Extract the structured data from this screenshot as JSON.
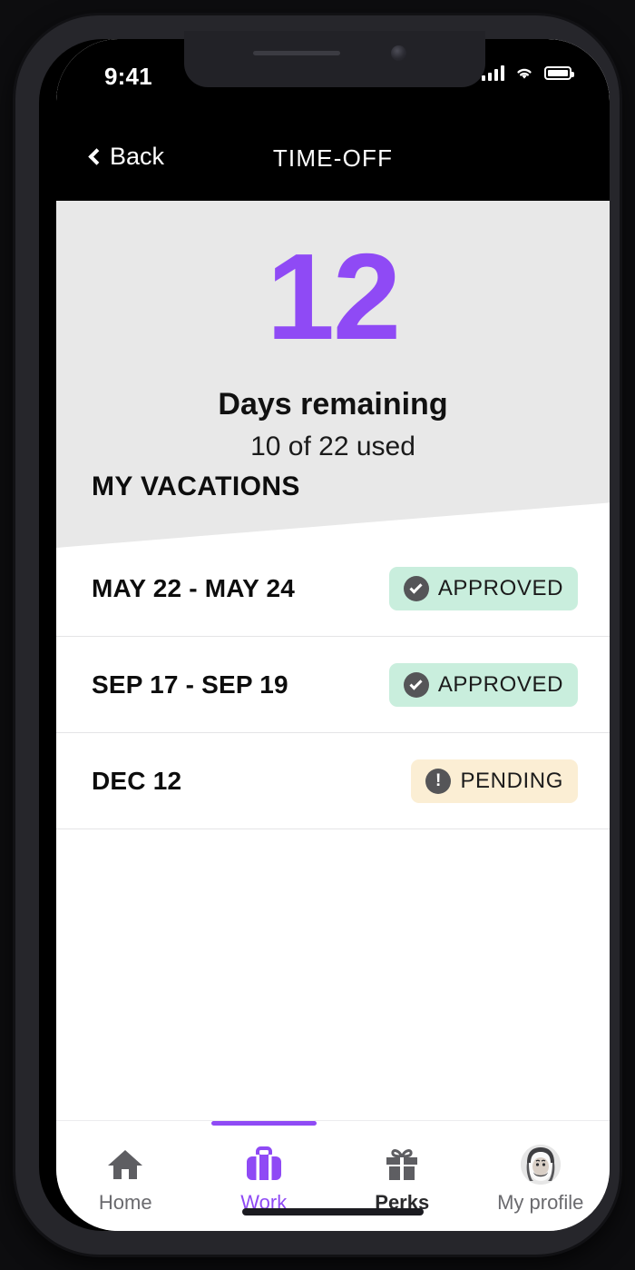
{
  "status_bar": {
    "time": "9:41",
    "signal_icon": "cellular-signal-icon",
    "wifi_icon": "wifi-icon",
    "battery_icon": "battery-full-icon"
  },
  "nav": {
    "back_label": "Back",
    "back_icon": "chevron-left-icon",
    "title": "TIME-OFF"
  },
  "hero": {
    "number": "12",
    "label": "Days remaining",
    "sub": "10 of 22 used",
    "accent_color": "#8f4af5",
    "background_color": "#e8e8e8"
  },
  "section": {
    "title": "MY VACATIONS"
  },
  "vacations": [
    {
      "dates": "MAY 22 - MAY 24",
      "status": "APPROVED",
      "status_type": "approved",
      "status_icon": "check-circle-icon",
      "badge_color": "#c9eedd"
    },
    {
      "dates": "SEP 17 - SEP 19",
      "status": "APPROVED",
      "status_type": "approved",
      "status_icon": "check-circle-icon",
      "badge_color": "#c9eedd"
    },
    {
      "dates": "DEC 12",
      "status": "PENDING",
      "status_type": "pending",
      "status_icon": "exclamation-circle-icon",
      "badge_color": "#fbeed4"
    }
  ],
  "tabs": [
    {
      "label": "Home",
      "icon": "home-icon",
      "active": false
    },
    {
      "label": "Work",
      "icon": "briefcase-icon",
      "active": true
    },
    {
      "label": "Perks",
      "icon": "gift-icon",
      "active": false
    },
    {
      "label": "My profile",
      "icon": "user-avatar-icon",
      "active": false
    }
  ]
}
